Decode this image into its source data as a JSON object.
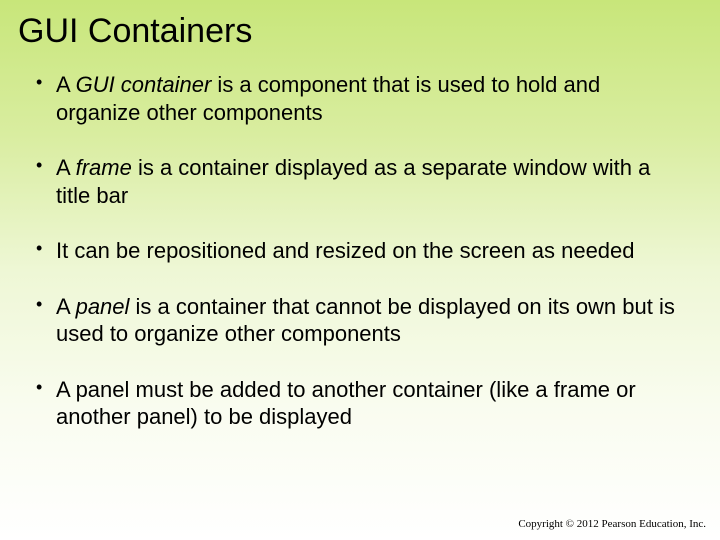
{
  "title": "GUI Containers",
  "bullets": [
    {
      "pre": "A ",
      "em": "GUI container",
      "post": " is a component that is used to hold and organize other components"
    },
    {
      "pre": "A ",
      "em": "frame",
      "post": " is a container displayed as a separate window with a title bar"
    },
    {
      "pre": "",
      "em": "",
      "post": "It can be repositioned and resized on the screen as needed"
    },
    {
      "pre": "A ",
      "em": "panel",
      "post": " is a container that cannot be displayed on its own but is used to organize other components"
    },
    {
      "pre": "",
      "em": "",
      "post": "A panel must be added to another container (like a frame or another panel) to be displayed"
    }
  ],
  "copyright": "Copyright © 2012 Pearson Education, Inc."
}
